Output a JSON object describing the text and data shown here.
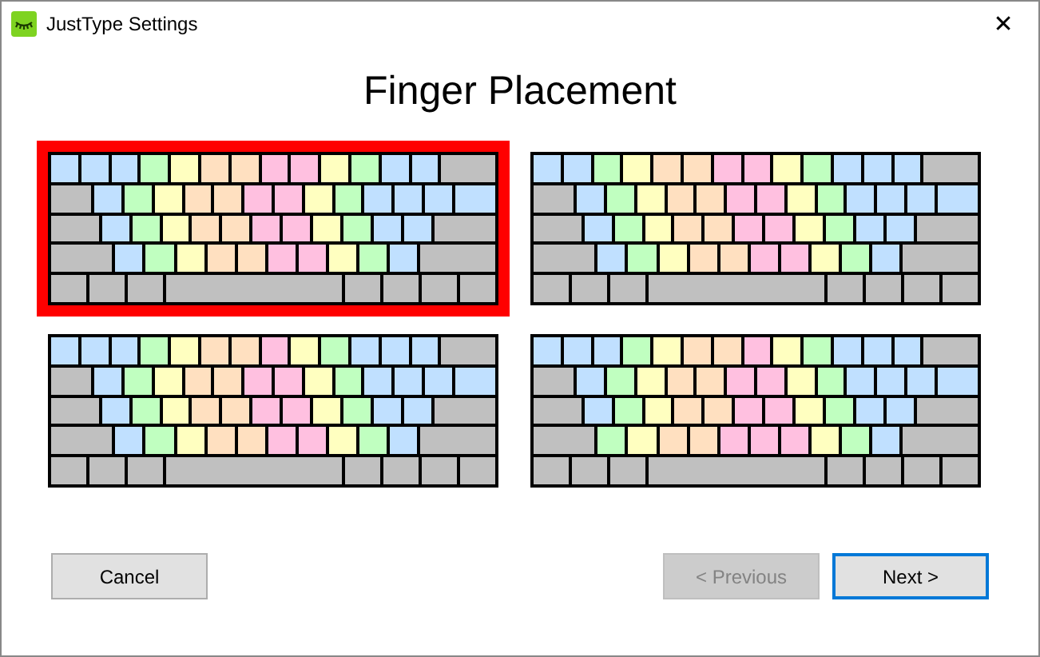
{
  "window": {
    "title": "JustType Settings",
    "close": "✕"
  },
  "heading": "Finger Placement",
  "keyboards": [
    {
      "selected": true,
      "rows": [
        [
          {
            "color": "#c0e0ff"
          },
          {
            "color": "#c0e0ff"
          },
          {
            "color": "#c0e0ff"
          },
          {
            "color": "#c0ffc0"
          },
          {
            "color": "#ffffc0"
          },
          {
            "color": "#ffe0c0"
          },
          {
            "color": "#ffe0c0"
          },
          {
            "color": "#ffc0e0"
          },
          {
            "color": "#ffc0e0"
          },
          {
            "color": "#ffffc0"
          },
          {
            "color": "#c0ffc0"
          },
          {
            "color": "#c0e0ff"
          },
          {
            "color": "#c0e0ff"
          },
          {
            "color": "#c0c0c0"
          }
        ],
        [
          {
            "color": "#c0c0c0"
          },
          {
            "color": "#c0e0ff"
          },
          {
            "color": "#c0ffc0"
          },
          {
            "color": "#ffffc0"
          },
          {
            "color": "#ffe0c0"
          },
          {
            "color": "#ffe0c0"
          },
          {
            "color": "#ffc0e0"
          },
          {
            "color": "#ffc0e0"
          },
          {
            "color": "#ffffc0"
          },
          {
            "color": "#c0ffc0"
          },
          {
            "color": "#c0e0ff"
          },
          {
            "color": "#c0e0ff"
          },
          {
            "color": "#c0e0ff"
          },
          {
            "color": "#c0e0ff"
          }
        ],
        [
          {
            "color": "#c0c0c0"
          },
          {
            "color": "#c0e0ff"
          },
          {
            "color": "#c0ffc0"
          },
          {
            "color": "#ffffc0"
          },
          {
            "color": "#ffe0c0"
          },
          {
            "color": "#ffe0c0"
          },
          {
            "color": "#ffc0e0"
          },
          {
            "color": "#ffc0e0"
          },
          {
            "color": "#ffffc0"
          },
          {
            "color": "#c0ffc0"
          },
          {
            "color": "#c0e0ff"
          },
          {
            "color": "#c0e0ff"
          },
          {
            "color": "#c0c0c0"
          }
        ],
        [
          {
            "color": "#c0c0c0"
          },
          {
            "color": "#c0e0ff"
          },
          {
            "color": "#c0ffc0"
          },
          {
            "color": "#ffffc0"
          },
          {
            "color": "#ffe0c0"
          },
          {
            "color": "#ffe0c0"
          },
          {
            "color": "#ffc0e0"
          },
          {
            "color": "#ffc0e0"
          },
          {
            "color": "#ffffc0"
          },
          {
            "color": "#c0ffc0"
          },
          {
            "color": "#c0e0ff"
          },
          {
            "color": "#c0c0c0"
          }
        ],
        [
          {
            "color": "#c0c0c0"
          },
          {
            "color": "#c0c0c0"
          },
          {
            "color": "#c0c0c0"
          },
          {
            "color": "#c0c0c0"
          },
          {
            "color": "#c0c0c0"
          },
          {
            "color": "#c0c0c0"
          },
          {
            "color": "#c0c0c0"
          },
          {
            "color": "#c0c0c0"
          }
        ]
      ]
    },
    {
      "selected": false,
      "rows": [
        [
          {
            "color": "#c0e0ff"
          },
          {
            "color": "#c0e0ff"
          },
          {
            "color": "#c0ffc0"
          },
          {
            "color": "#ffffc0"
          },
          {
            "color": "#ffe0c0"
          },
          {
            "color": "#ffe0c0"
          },
          {
            "color": "#ffc0e0"
          },
          {
            "color": "#ffc0e0"
          },
          {
            "color": "#ffffc0"
          },
          {
            "color": "#c0ffc0"
          },
          {
            "color": "#c0e0ff"
          },
          {
            "color": "#c0e0ff"
          },
          {
            "color": "#c0e0ff"
          },
          {
            "color": "#c0c0c0"
          }
        ],
        [
          {
            "color": "#c0c0c0"
          },
          {
            "color": "#c0e0ff"
          },
          {
            "color": "#c0ffc0"
          },
          {
            "color": "#ffffc0"
          },
          {
            "color": "#ffe0c0"
          },
          {
            "color": "#ffe0c0"
          },
          {
            "color": "#ffc0e0"
          },
          {
            "color": "#ffc0e0"
          },
          {
            "color": "#ffffc0"
          },
          {
            "color": "#c0ffc0"
          },
          {
            "color": "#c0e0ff"
          },
          {
            "color": "#c0e0ff"
          },
          {
            "color": "#c0e0ff"
          },
          {
            "color": "#c0e0ff"
          }
        ],
        [
          {
            "color": "#c0c0c0"
          },
          {
            "color": "#c0e0ff"
          },
          {
            "color": "#c0ffc0"
          },
          {
            "color": "#ffffc0"
          },
          {
            "color": "#ffe0c0"
          },
          {
            "color": "#ffe0c0"
          },
          {
            "color": "#ffc0e0"
          },
          {
            "color": "#ffc0e0"
          },
          {
            "color": "#ffffc0"
          },
          {
            "color": "#c0ffc0"
          },
          {
            "color": "#c0e0ff"
          },
          {
            "color": "#c0e0ff"
          },
          {
            "color": "#c0c0c0"
          }
        ],
        [
          {
            "color": "#c0c0c0"
          },
          {
            "color": "#c0e0ff"
          },
          {
            "color": "#c0ffc0"
          },
          {
            "color": "#ffffc0"
          },
          {
            "color": "#ffe0c0"
          },
          {
            "color": "#ffe0c0"
          },
          {
            "color": "#ffc0e0"
          },
          {
            "color": "#ffc0e0"
          },
          {
            "color": "#ffffc0"
          },
          {
            "color": "#c0ffc0"
          },
          {
            "color": "#c0e0ff"
          },
          {
            "color": "#c0c0c0"
          }
        ],
        [
          {
            "color": "#c0c0c0"
          },
          {
            "color": "#c0c0c0"
          },
          {
            "color": "#c0c0c0"
          },
          {
            "color": "#c0c0c0"
          },
          {
            "color": "#c0c0c0"
          },
          {
            "color": "#c0c0c0"
          },
          {
            "color": "#c0c0c0"
          },
          {
            "color": "#c0c0c0"
          }
        ]
      ]
    },
    {
      "selected": false,
      "rows": [
        [
          {
            "color": "#c0e0ff"
          },
          {
            "color": "#c0e0ff"
          },
          {
            "color": "#c0e0ff"
          },
          {
            "color": "#c0ffc0"
          },
          {
            "color": "#ffffc0"
          },
          {
            "color": "#ffe0c0"
          },
          {
            "color": "#ffe0c0"
          },
          {
            "color": "#ffc0e0"
          },
          {
            "color": "#ffffc0"
          },
          {
            "color": "#c0ffc0"
          },
          {
            "color": "#c0e0ff"
          },
          {
            "color": "#c0e0ff"
          },
          {
            "color": "#c0e0ff"
          },
          {
            "color": "#c0c0c0"
          }
        ],
        [
          {
            "color": "#c0c0c0"
          },
          {
            "color": "#c0e0ff"
          },
          {
            "color": "#c0ffc0"
          },
          {
            "color": "#ffffc0"
          },
          {
            "color": "#ffe0c0"
          },
          {
            "color": "#ffe0c0"
          },
          {
            "color": "#ffc0e0"
          },
          {
            "color": "#ffc0e0"
          },
          {
            "color": "#ffffc0"
          },
          {
            "color": "#c0ffc0"
          },
          {
            "color": "#c0e0ff"
          },
          {
            "color": "#c0e0ff"
          },
          {
            "color": "#c0e0ff"
          },
          {
            "color": "#c0e0ff"
          }
        ],
        [
          {
            "color": "#c0c0c0"
          },
          {
            "color": "#c0e0ff"
          },
          {
            "color": "#c0ffc0"
          },
          {
            "color": "#ffffc0"
          },
          {
            "color": "#ffe0c0"
          },
          {
            "color": "#ffe0c0"
          },
          {
            "color": "#ffc0e0"
          },
          {
            "color": "#ffc0e0"
          },
          {
            "color": "#ffffc0"
          },
          {
            "color": "#c0ffc0"
          },
          {
            "color": "#c0e0ff"
          },
          {
            "color": "#c0e0ff"
          },
          {
            "color": "#c0c0c0"
          }
        ],
        [
          {
            "color": "#c0c0c0"
          },
          {
            "color": "#c0e0ff"
          },
          {
            "color": "#c0ffc0"
          },
          {
            "color": "#ffffc0"
          },
          {
            "color": "#ffe0c0"
          },
          {
            "color": "#ffe0c0"
          },
          {
            "color": "#ffc0e0"
          },
          {
            "color": "#ffc0e0"
          },
          {
            "color": "#ffffc0"
          },
          {
            "color": "#c0ffc0"
          },
          {
            "color": "#c0e0ff"
          },
          {
            "color": "#c0c0c0"
          }
        ],
        [
          {
            "color": "#c0c0c0"
          },
          {
            "color": "#c0c0c0"
          },
          {
            "color": "#c0c0c0"
          },
          {
            "color": "#c0c0c0"
          },
          {
            "color": "#c0c0c0"
          },
          {
            "color": "#c0c0c0"
          },
          {
            "color": "#c0c0c0"
          },
          {
            "color": "#c0c0c0"
          }
        ]
      ]
    },
    {
      "selected": false,
      "rows": [
        [
          {
            "color": "#c0e0ff"
          },
          {
            "color": "#c0e0ff"
          },
          {
            "color": "#c0e0ff"
          },
          {
            "color": "#c0ffc0"
          },
          {
            "color": "#ffffc0"
          },
          {
            "color": "#ffe0c0"
          },
          {
            "color": "#ffe0c0"
          },
          {
            "color": "#ffc0e0"
          },
          {
            "color": "#ffffc0"
          },
          {
            "color": "#c0ffc0"
          },
          {
            "color": "#c0e0ff"
          },
          {
            "color": "#c0e0ff"
          },
          {
            "color": "#c0e0ff"
          },
          {
            "color": "#c0c0c0"
          }
        ],
        [
          {
            "color": "#c0c0c0"
          },
          {
            "color": "#c0e0ff"
          },
          {
            "color": "#c0ffc0"
          },
          {
            "color": "#ffffc0"
          },
          {
            "color": "#ffe0c0"
          },
          {
            "color": "#ffe0c0"
          },
          {
            "color": "#ffc0e0"
          },
          {
            "color": "#ffc0e0"
          },
          {
            "color": "#ffffc0"
          },
          {
            "color": "#c0ffc0"
          },
          {
            "color": "#c0e0ff"
          },
          {
            "color": "#c0e0ff"
          },
          {
            "color": "#c0e0ff"
          },
          {
            "color": "#c0e0ff"
          }
        ],
        [
          {
            "color": "#c0c0c0"
          },
          {
            "color": "#c0e0ff"
          },
          {
            "color": "#c0ffc0"
          },
          {
            "color": "#ffffc0"
          },
          {
            "color": "#ffe0c0"
          },
          {
            "color": "#ffe0c0"
          },
          {
            "color": "#ffc0e0"
          },
          {
            "color": "#ffc0e0"
          },
          {
            "color": "#ffffc0"
          },
          {
            "color": "#c0ffc0"
          },
          {
            "color": "#c0e0ff"
          },
          {
            "color": "#c0e0ff"
          },
          {
            "color": "#c0c0c0"
          }
        ],
        [
          {
            "color": "#c0c0c0"
          },
          {
            "color": "#c0ffc0"
          },
          {
            "color": "#ffffc0"
          },
          {
            "color": "#ffe0c0"
          },
          {
            "color": "#ffe0c0"
          },
          {
            "color": "#ffc0e0"
          },
          {
            "color": "#ffc0e0"
          },
          {
            "color": "#ffc0e0"
          },
          {
            "color": "#ffffc0"
          },
          {
            "color": "#c0ffc0"
          },
          {
            "color": "#c0e0ff"
          },
          {
            "color": "#c0c0c0"
          }
        ],
        [
          {
            "color": "#c0c0c0"
          },
          {
            "color": "#c0c0c0"
          },
          {
            "color": "#c0c0c0"
          },
          {
            "color": "#c0c0c0"
          },
          {
            "color": "#c0c0c0"
          },
          {
            "color": "#c0c0c0"
          },
          {
            "color": "#c0c0c0"
          },
          {
            "color": "#c0c0c0"
          }
        ]
      ]
    }
  ],
  "buttons": [
    {
      "label": "Cancel",
      "kind": "normal"
    },
    {
      "label": "< Previous",
      "kind": "disabled"
    },
    {
      "label": "Next >",
      "kind": "default"
    }
  ]
}
